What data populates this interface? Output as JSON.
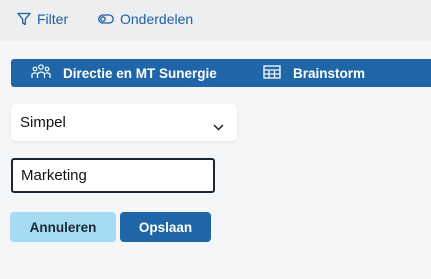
{
  "toolbar": {
    "filter_label": "Filter",
    "filter_icon": "filter-icon",
    "parts_label": "Onderdelen",
    "parts_icon": "toggle-icon"
  },
  "nav": {
    "team_label": "Directie en MT Sunergie",
    "team_icon": "people-icon",
    "board_label": "Brainstorm",
    "board_icon": "table-icon"
  },
  "form": {
    "view_select_value": "Simpel",
    "name_value": "Marketing",
    "cancel_label": "Annuleren",
    "save_label": "Opslaan"
  },
  "colors": {
    "accent": "#1f66a8",
    "cancel_bg": "#a6dcf3",
    "toolbar_bg": "#eceeef",
    "page_bg": "#f5f6f7"
  }
}
